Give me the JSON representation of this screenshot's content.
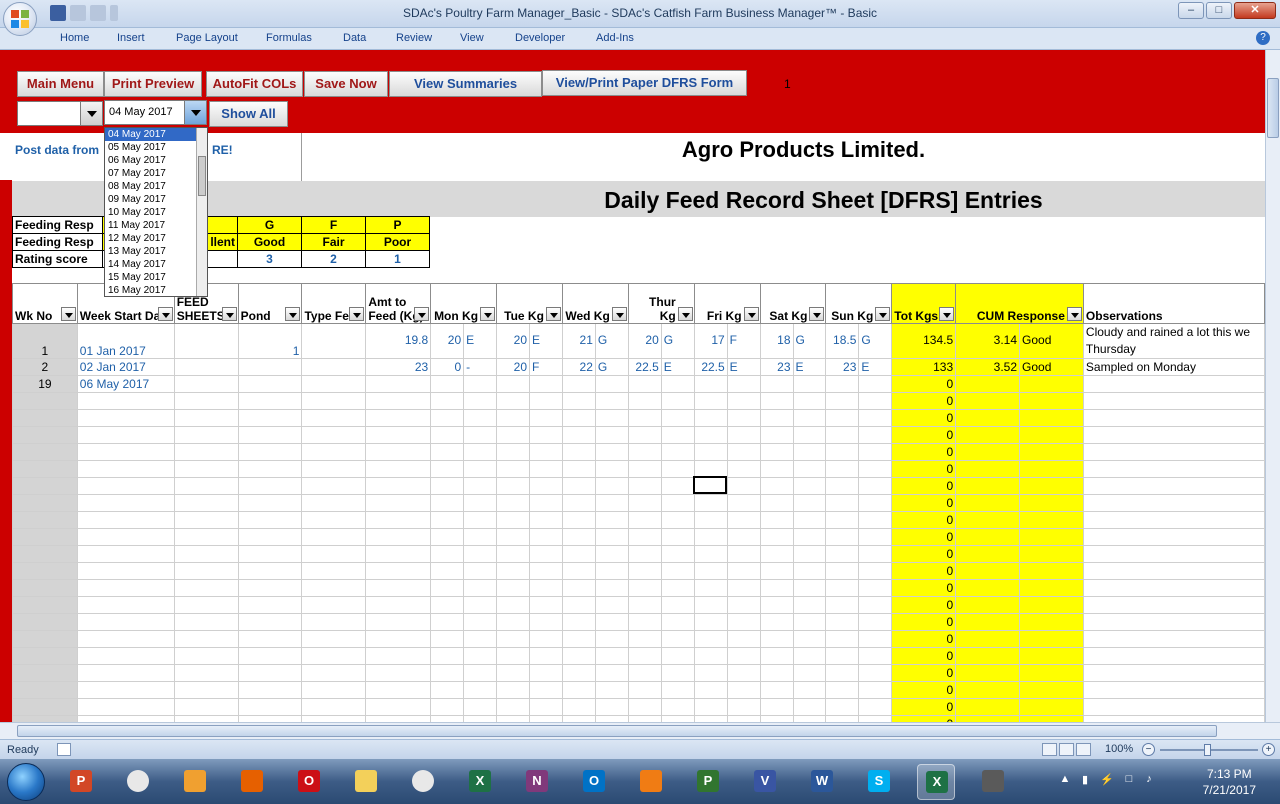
{
  "window": {
    "title": "SDAc's Poultry Farm Manager_Basic - SDAc's Catfish Farm Business Manager™ - Basic"
  },
  "ribbon": {
    "tabs": [
      "Home",
      "Insert",
      "Page Layout",
      "Formulas",
      "Data",
      "Review",
      "View",
      "Developer",
      "Add-Ins"
    ]
  },
  "toolbar": {
    "main_menu": "Main Menu",
    "print_preview": "Print Preview",
    "autofit": "AutoFit COLs",
    "save_now": "Save Now",
    "view_summaries": "View Summaries",
    "view_print": "View/Print Paper DFRS Form",
    "counter": "1",
    "date_value": "04 May 2017",
    "show_all": "Show All"
  },
  "date_dropdown": {
    "options": [
      "04 May 2017",
      "05 May 2017",
      "06 May 2017",
      "07 May 2017",
      "08 May 2017",
      "09 May 2017",
      "10 May 2017",
      "11 May 2017",
      "12 May 2017",
      "13 May 2017",
      "14 May 2017",
      "15 May 2017",
      "16 May 2017"
    ],
    "selected": "04 May 2017"
  },
  "sheet": {
    "post_data": "Post data from",
    "post_data_tail": "RE!",
    "company": "Agro Products Limited.",
    "heading": "Daily Feed Record Sheet [DFRS] Entries"
  },
  "legend": {
    "row1_label": "Feeding Resp",
    "row2_label": "Feeding Resp",
    "row3_label": "Rating score",
    "hidden_cell": "llent",
    "cols": [
      {
        "code": "G",
        "name": "Good",
        "score": "3"
      },
      {
        "code": "F",
        "name": "Fair",
        "score": "2"
      },
      {
        "code": "P",
        "name": "Poor",
        "score": "1"
      }
    ]
  },
  "table": {
    "headers": {
      "wk": "Wk No",
      "week_start": "Week Start Date",
      "feed_sheets": "FEED SHEETS",
      "pond": "Pond",
      "type_feed": "Type Feed",
      "amt": "Amt to Feed (Kg)",
      "mon": "Mon Kg",
      "tue": "Tue Kg",
      "wed": "Wed Kg",
      "thur": "Thur Kg",
      "fri": "Fri Kg",
      "sat": "Sat Kg",
      "sun": "Sun Kg",
      "tot": "Tot Kgs",
      "cum": "CUM Response",
      "obs": "Observations"
    },
    "rows": [
      {
        "wk": "1",
        "date": "01 Jan 2017",
        "pond": "1",
        "amt": "19.8",
        "mon": "20",
        "mon_r": "E",
        "tue": "20",
        "tue_r": "E",
        "wed": "21",
        "wed_r": "G",
        "thu": "20",
        "thu_r": "G",
        "fri": "17",
        "fri_r": "F",
        "sat": "18",
        "sat_r": "G",
        "sun": "18.5",
        "sun_r": "G",
        "tot": "134.5",
        "cum": "3.14",
        "cum_r": "Good",
        "obs": "Cloudy and rained a lot this we",
        "obs2": "Thursday"
      },
      {
        "wk": "2",
        "date": "02 Jan 2017",
        "pond": "",
        "amt": "23",
        "mon": "0",
        "mon_r": "-",
        "tue": "20",
        "tue_r": "F",
        "wed": "22",
        "wed_r": "G",
        "thu": "22.5",
        "thu_r": "E",
        "fri": "22.5",
        "fri_r": "E",
        "sat": "23",
        "sat_r": "E",
        "sun": "23",
        "sun_r": "E",
        "tot": "133",
        "cum": "3.52",
        "cum_r": "Good",
        "obs": "Sampled on Monday",
        "obs2": ""
      },
      {
        "wk": "19",
        "date": "06 May 2017",
        "pond": "",
        "amt": "",
        "mon": "",
        "mon_r": "",
        "tue": "",
        "tue_r": "",
        "wed": "",
        "wed_r": "",
        "thu": "",
        "thu_r": "",
        "fri": "",
        "fri_r": "",
        "sat": "",
        "sat_r": "",
        "sun": "",
        "sun_r": "",
        "tot": "0",
        "cum": "",
        "cum_r": "",
        "obs": "",
        "obs2": ""
      }
    ],
    "zero_rows": [
      "0",
      "0",
      "0",
      "0",
      "0",
      "0",
      "0",
      "0",
      "0",
      "0",
      "0",
      "0",
      "0",
      "0",
      "0",
      "0",
      "0",
      "0",
      "0",
      "0"
    ]
  },
  "status": {
    "ready": "Ready",
    "zoom": "100%"
  },
  "taskbar": {
    "time": "7:13 PM",
    "date": "7/21/2017",
    "apps": [
      "powerpoint-icon",
      "chrome-icon",
      "media-player-icon",
      "firefox-icon",
      "opera-icon",
      "file-explorer-icon",
      "chrome-icon",
      "excel-icon",
      "onenote-icon",
      "outlook-icon",
      "uc-browser-icon",
      "project-icon",
      "visio-icon",
      "word-icon",
      "skype-icon",
      "excel-active-icon",
      "media-center-icon"
    ]
  },
  "colors": {
    "red_band": "#cc0000",
    "highlight_yellow": "#ffff00",
    "data_blue": "#1f60a8"
  }
}
